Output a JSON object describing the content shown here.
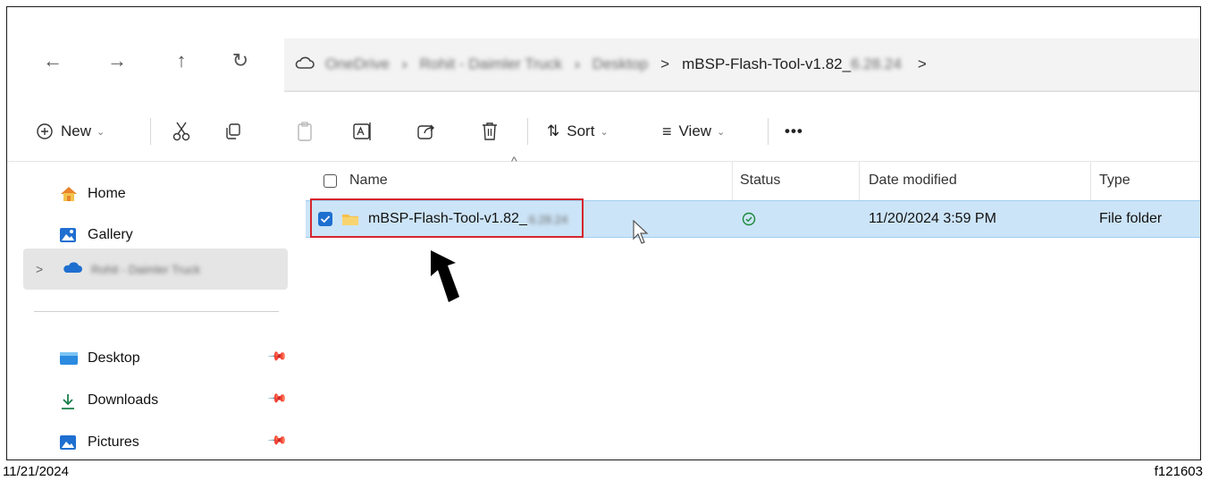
{
  "address": {
    "segments": [
      "OneDrive",
      "Rohit - Daimler Truck",
      "Desktop",
      "mBSP-Flash-Tool-v1.82_",
      "6.28.24"
    ],
    "icons": [
      "back-icon",
      "forward-icon",
      "up-icon",
      "refresh-icon",
      "cloud-icon"
    ]
  },
  "toolbar": {
    "new_label": "New",
    "sort_label": "Sort",
    "view_label": "View",
    "more_label": "•••"
  },
  "sidebar": {
    "home": "Home",
    "gallery": "Gallery",
    "cloud": "Rohit - Daimler Truck",
    "desktop": "Desktop",
    "downloads": "Downloads",
    "pictures": "Pictures"
  },
  "columns": {
    "name": "Name",
    "status": "Status",
    "date": "Date modified",
    "type": "Type"
  },
  "file": {
    "name": "mBSP-Flash-Tool-v1.82_",
    "name_suffix": "6.28.24",
    "date": "11/20/2024 3:59 PM",
    "type": "File folder"
  },
  "footer": {
    "left": "11/21/2024",
    "right": "f121603"
  },
  "colors": {
    "selection": "#cce4f7",
    "highlight_box": "#d6262d",
    "accent": "#1f6fd0"
  }
}
